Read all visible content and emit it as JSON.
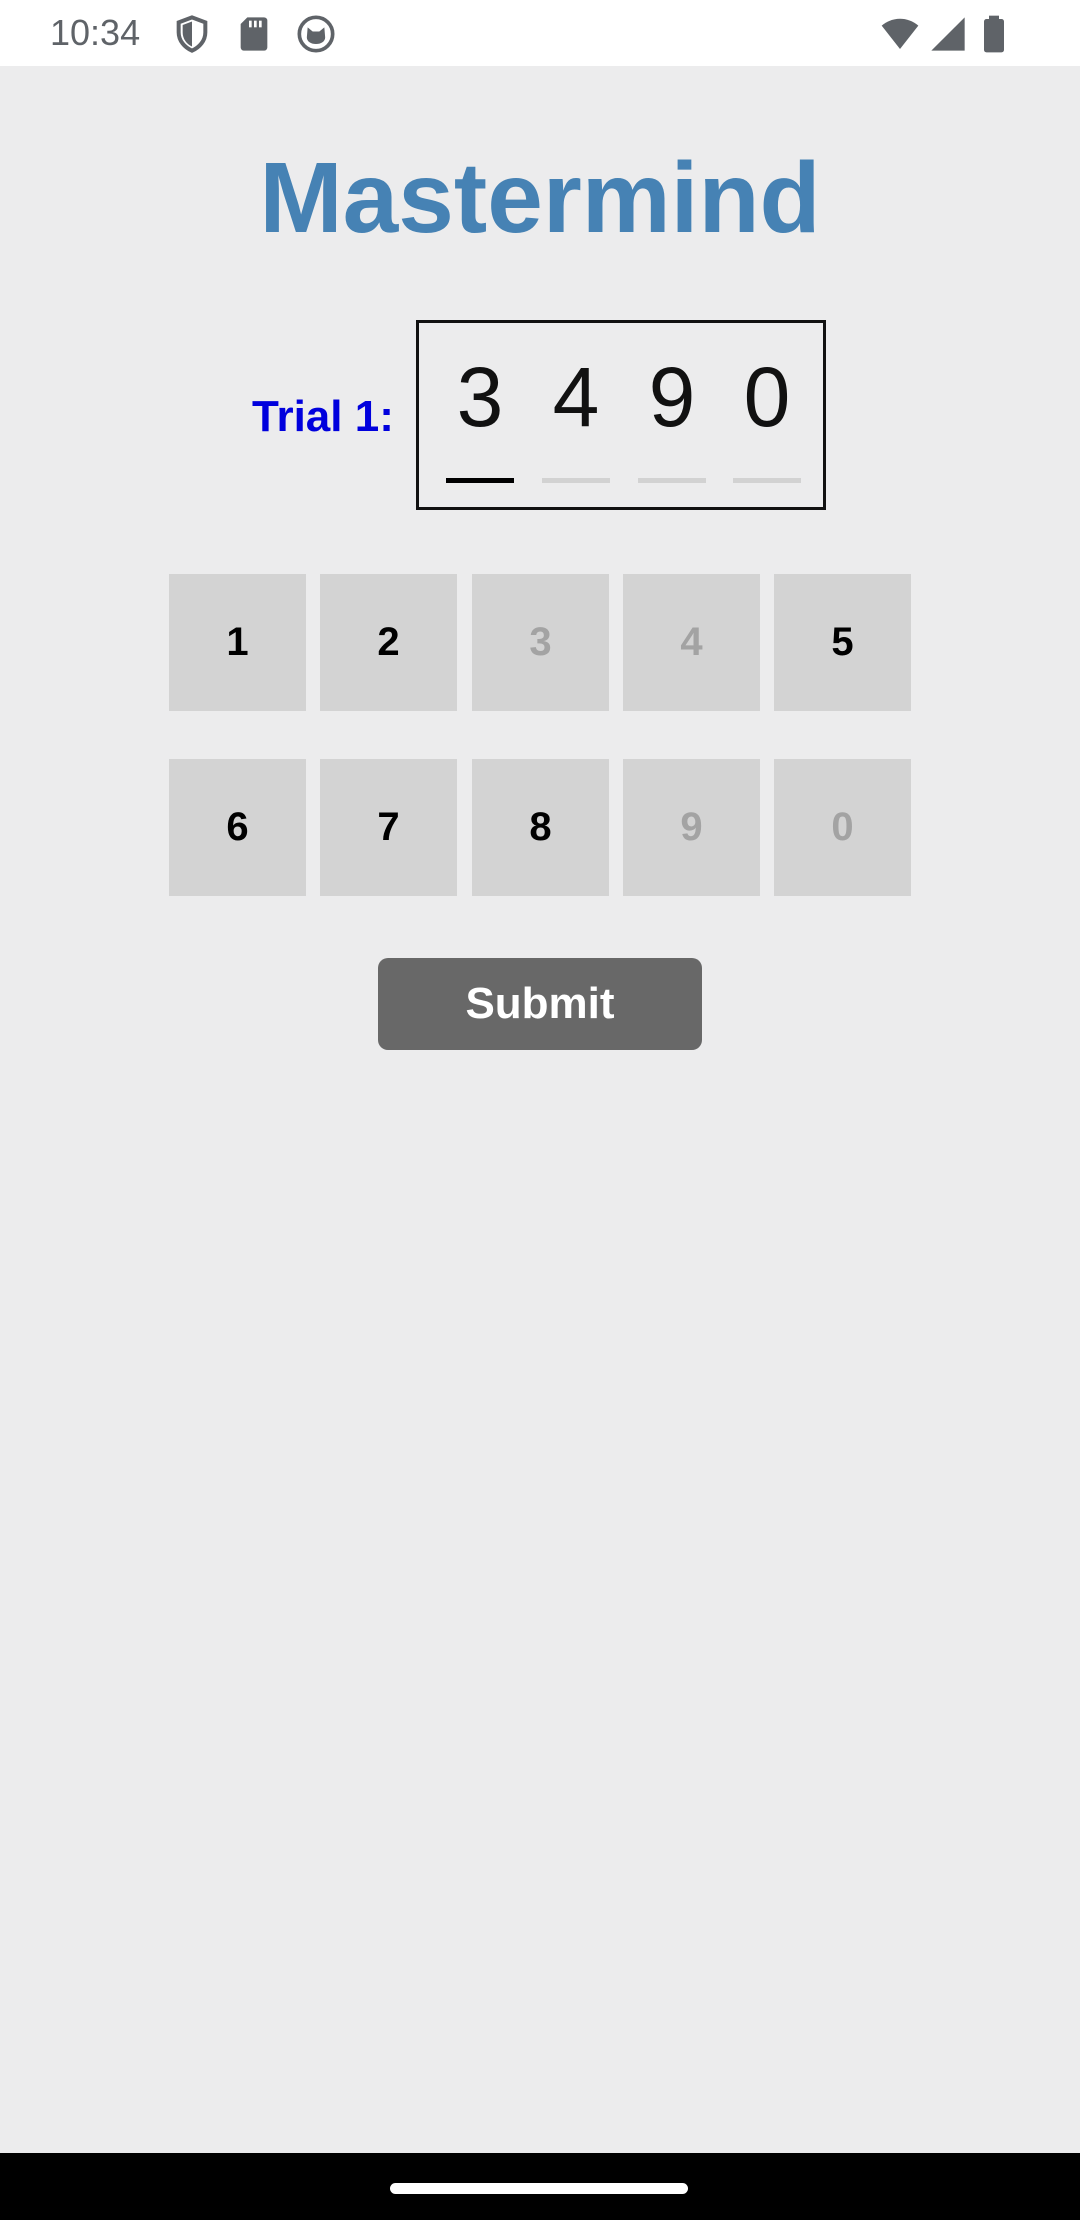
{
  "status_bar": {
    "time": "10:34",
    "icons": [
      "shield-icon",
      "sd-card-icon",
      "cat-face-icon",
      "wifi-icon",
      "cellular-signal-icon",
      "battery-icon"
    ]
  },
  "app": {
    "title": "Mastermind"
  },
  "trial": {
    "label": "Trial 1:",
    "digits": [
      "3",
      "4",
      "9",
      "0"
    ],
    "active_index": 0
  },
  "keypad": {
    "keys": [
      {
        "label": "1",
        "disabled": false
      },
      {
        "label": "2",
        "disabled": false
      },
      {
        "label": "3",
        "disabled": true
      },
      {
        "label": "4",
        "disabled": true
      },
      {
        "label": "5",
        "disabled": false
      },
      {
        "label": "6",
        "disabled": false
      },
      {
        "label": "7",
        "disabled": false
      },
      {
        "label": "8",
        "disabled": false
      },
      {
        "label": "9",
        "disabled": true
      },
      {
        "label": "0",
        "disabled": true
      }
    ]
  },
  "submit": {
    "label": "Submit"
  },
  "colors": {
    "title": "#4682b4",
    "trial_label": "#0000dd",
    "key_background": "#d3d3d3",
    "key_disabled_text": "#a3a3a3",
    "submit_background": "#686868",
    "page_background": "#ececed"
  }
}
